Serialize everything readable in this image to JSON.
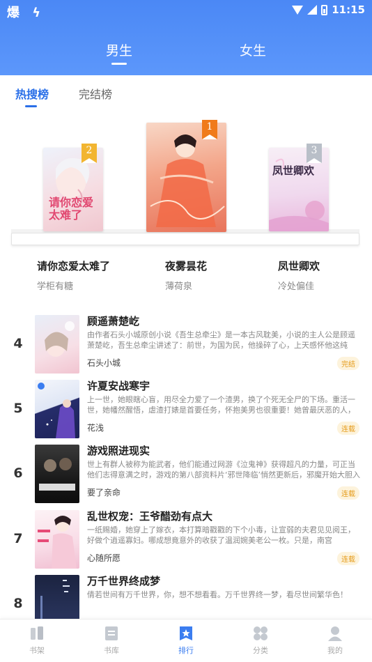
{
  "status_bar": {
    "time": "11:15",
    "left_icons": "爆 ϟ"
  },
  "gender_tabs": [
    {
      "label": "男生",
      "active": true
    },
    {
      "label": "女生",
      "active": false
    }
  ],
  "rank_tabs": [
    {
      "label": "热搜榜",
      "active": true
    },
    {
      "label": "完结榜",
      "active": false
    }
  ],
  "podium": [
    {
      "rank": "2",
      "title": "请你恋爱太难了",
      "author": "学柜有糖",
      "cover_text": "请你恋爱太难了"
    },
    {
      "rank": "1",
      "title": "夜雾昙花",
      "author": "薄荷泉"
    },
    {
      "rank": "3",
      "title": "凤世卿欢",
      "author": "冷处偏佳",
      "cover_text": "凤世卿欢"
    }
  ],
  "list": [
    {
      "rank": "4",
      "title": "顾遥萧楚屹",
      "desc": "由作者石头小城原创小说《吾生总牵尘》是一本古风耽美，小说的主人公是顾遥萧楚屹，吾生总牵尘讲述了：前世，为国为民，他操碎了心，上天感怀他这纯",
      "author": "石头小城",
      "status": "完结"
    },
    {
      "rank": "5",
      "title": "许夏安战寒宇",
      "desc": "上一世，她眼瞎心盲，用尽全力爱了一个渣男，换了个死无全尸的下场。重活一世，她幡然醒悟，虐渣打婊是首要任务，怀抱美男也很重要！她曾最厌恶的人，",
      "author": "花浅",
      "status": "连载"
    },
    {
      "rank": "6",
      "title": "游戏照进现实",
      "desc": "世上有群人被称为能武者，他们能通过网游《泣鬼神》获得超凡的力量，可正当他们志得意满之时，游戏的第八部资料片‘邪世降临’悄然更新后，邪魔开始大胆入",
      "author": "要了亲命",
      "status": "连载"
    },
    {
      "rank": "7",
      "title": "乱世权宠：王爷醋劲有点大",
      "desc": "一纸赐婚，她穿上了嫁衣，本打算暗戳戳的下个小毒，让宣弱的夫君见见阅王，好做个逍遥寡妇。哪成想竟意外的收获了温润婉美老公一枚。只是，南宫",
      "author": "心随所愿",
      "status": "连载"
    },
    {
      "rank": "8",
      "title": "万千世界终成梦",
      "desc": "倩若世间有万千世界，你，想不想看看。万千世界终一梦，看尽世间繁华色！",
      "author": "",
      "status": ""
    }
  ],
  "bottom_nav": [
    {
      "label": "书架",
      "icon": "bookshelf-icon",
      "active": false
    },
    {
      "label": "书库",
      "icon": "library-icon",
      "active": false
    },
    {
      "label": "排行",
      "icon": "ranking-star-icon",
      "active": true
    },
    {
      "label": "分类",
      "icon": "category-icon",
      "active": false
    },
    {
      "label": "我的",
      "icon": "profile-icon",
      "active": false
    }
  ],
  "colors": {
    "header_blue": "#4b88f5",
    "accent_blue": "#2a6fe8",
    "tag_orange": "#e59b1a",
    "badge_gold": "#f2b531",
    "badge_orange": "#f07b1b",
    "badge_silver": "#b9bfc8"
  }
}
